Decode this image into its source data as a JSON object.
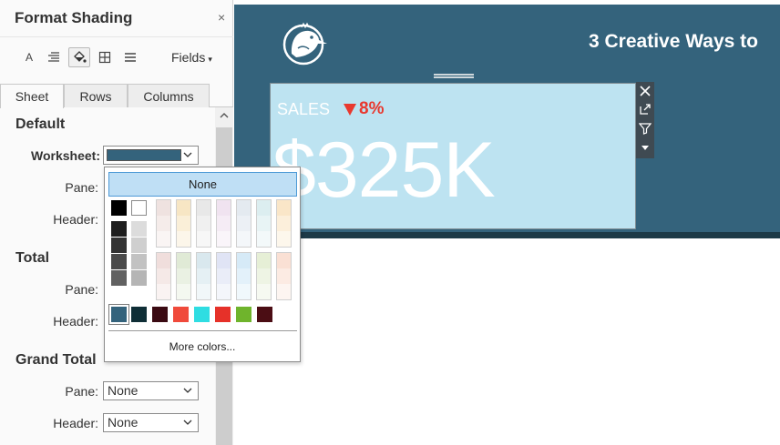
{
  "pane": {
    "title": "Format Shading",
    "close_symbol": "×",
    "toolbar": {
      "font_icon_glyph": "A",
      "fields_label": "Fields",
      "fields_caret": "▾"
    },
    "tabs": [
      "Sheet",
      "Rows",
      "Columns"
    ],
    "sections": {
      "default": {
        "title": "Default",
        "worksheet_label": "Worksheet:",
        "pane_label": "Pane:",
        "header_label": "Header:",
        "worksheet_color": "#34637c"
      },
      "total": {
        "title": "Total",
        "pane_label": "Pane:",
        "header_label": "Header:"
      },
      "grand_total": {
        "title": "Grand Total",
        "pane_label": "Pane:",
        "pane_value": "None",
        "header_label": "Header:",
        "header_value": "None"
      }
    }
  },
  "picker": {
    "none_label": "None",
    "more_colors_label": "More colors...",
    "basic_colors": [
      "#000000",
      "#ffffff"
    ],
    "gray_ramp_dark": [
      "#1e1e1e",
      "#333333",
      "#4a4a4a",
      "#616161"
    ],
    "gray_ramp_light": [
      "#dcdcdc",
      "#cfcfcf",
      "#c2c2c2",
      "#b5b5b5"
    ],
    "gray_ramp_pair": [
      [
        "#555555",
        "#a8a8a8"
      ],
      [
        "#767676",
        "#9a9a9a"
      ]
    ],
    "pastel_top": [
      [
        "#efe2e0",
        "#f5ecea",
        "#faf5f4"
      ],
      [
        "#f7e6c4",
        "#faefd8",
        "#fcf6ea"
      ],
      [
        "#e8e8e8",
        "#f0f0f0",
        "#f7f7f7"
      ],
      [
        "#f0e3f0",
        "#f5ecf5",
        "#faf5fa"
      ],
      [
        "#e4eaf0",
        "#ecf0f5",
        "#f4f7fa"
      ],
      [
        "#dceef0",
        "#e8f4f5",
        "#f3f9fa"
      ],
      [
        "#fae6c8",
        "#fcefdb",
        "#fdf7ec"
      ]
    ],
    "pastel_bottom": [
      [
        "#f0dedc",
        "#f5e9e7",
        "#faf3f2"
      ],
      [
        "#e0ead6",
        "#eaf1e3",
        "#f4f8f0"
      ],
      [
        "#d9e8ee",
        "#e5f0f4",
        "#f1f7f9"
      ],
      [
        "#e0e4f5",
        "#eaedf8",
        "#f4f6fb"
      ],
      [
        "#d6eaf7",
        "#e3f1fa",
        "#f0f8fc"
      ],
      [
        "#e6efd6",
        "#eef4e4",
        "#f6f9f1"
      ],
      [
        "#fae0d4",
        "#fcebe3",
        "#fdf5f1"
      ]
    ],
    "recent_colors": [
      "#34637c",
      "#0f2e36",
      "#3a0a12",
      "#f04a3b",
      "#2fdde2",
      "#e63129",
      "#6fb42c",
      "#4b0d14"
    ]
  },
  "dashboard": {
    "title": "3 Creative Ways to",
    "background_color": "#34637c",
    "kpi": {
      "label": "SALES",
      "delta": "8%",
      "delta_direction": "down",
      "delta_color": "#e8392f",
      "value": "$325K",
      "background_color": "#bde3f1"
    }
  }
}
